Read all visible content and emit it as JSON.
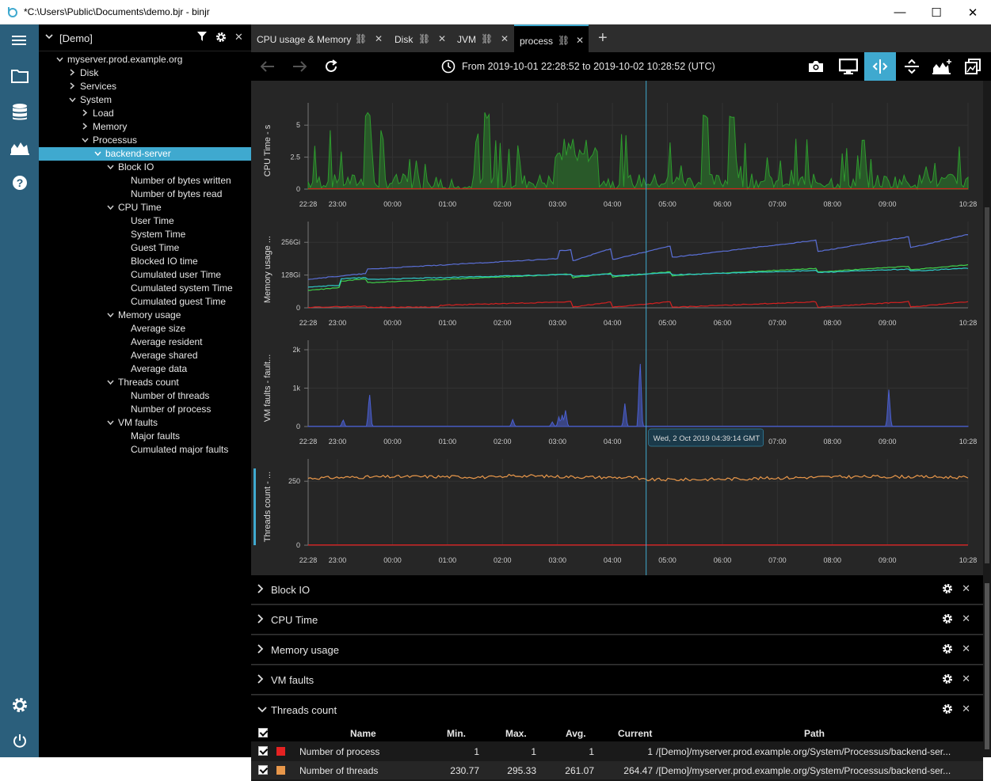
{
  "window": {
    "title": "*C:\\Users\\Public\\Documents\\demo.bjr - binjr",
    "minimize": "—",
    "maximize": "☐",
    "close": "✕"
  },
  "tree": {
    "root_label": "[Demo]",
    "nodes": [
      {
        "label": "myserver.prod.example.org",
        "depth": 0,
        "chev": "v"
      },
      {
        "label": "Disk",
        "depth": 1,
        "chev": ">"
      },
      {
        "label": "Services",
        "depth": 1,
        "chev": ">"
      },
      {
        "label": "System",
        "depth": 1,
        "chev": "v"
      },
      {
        "label": "Load",
        "depth": 2,
        "chev": ">"
      },
      {
        "label": "Memory",
        "depth": 2,
        "chev": ">"
      },
      {
        "label": "Processus",
        "depth": 2,
        "chev": "v"
      },
      {
        "label": "backend-server",
        "depth": 3,
        "chev": "v",
        "selected": true
      },
      {
        "label": "Block IO",
        "depth": 4,
        "chev": "v"
      },
      {
        "label": "Number of bytes written",
        "depth": 5,
        "chev": ""
      },
      {
        "label": "Number of bytes read",
        "depth": 5,
        "chev": ""
      },
      {
        "label": "CPU Time",
        "depth": 4,
        "chev": "v"
      },
      {
        "label": "User Time",
        "depth": 5,
        "chev": ""
      },
      {
        "label": "System Time",
        "depth": 5,
        "chev": ""
      },
      {
        "label": "Guest Time",
        "depth": 5,
        "chev": ""
      },
      {
        "label": "Blocked IO time",
        "depth": 5,
        "chev": ""
      },
      {
        "label": "Cumulated user Time",
        "depth": 5,
        "chev": ""
      },
      {
        "label": "Cumulated system Time",
        "depth": 5,
        "chev": ""
      },
      {
        "label": "Cumulated guest Time",
        "depth": 5,
        "chev": ""
      },
      {
        "label": "Memory usage",
        "depth": 4,
        "chev": "v"
      },
      {
        "label": "Average size",
        "depth": 5,
        "chev": ""
      },
      {
        "label": "Average resident",
        "depth": 5,
        "chev": ""
      },
      {
        "label": "Average shared",
        "depth": 5,
        "chev": ""
      },
      {
        "label": "Average data",
        "depth": 5,
        "chev": ""
      },
      {
        "label": "Threads count",
        "depth": 4,
        "chev": "v"
      },
      {
        "label": "Number of threads",
        "depth": 5,
        "chev": ""
      },
      {
        "label": "Number of process",
        "depth": 5,
        "chev": ""
      },
      {
        "label": "VM faults",
        "depth": 4,
        "chev": "v"
      },
      {
        "label": "Major faults",
        "depth": 5,
        "chev": ""
      },
      {
        "label": "Cumulated major faults",
        "depth": 5,
        "chev": ""
      }
    ]
  },
  "tabs": [
    {
      "label": "CPU usage & Memory"
    },
    {
      "label": "Disk"
    },
    {
      "label": "JVM"
    },
    {
      "label": "process",
      "active": true
    }
  ],
  "toolbar": {
    "time_range": "From 2019-10-01 22:28:52 to 2019-10-02 10:28:52 (UTC)"
  },
  "colors": {
    "accent": "#3fa9cf",
    "cpu_green": "#2e9a2e",
    "mem_blue": "#5a6fd6",
    "mem_green": "#3fd14a",
    "mem_cyan": "#2ec9c9",
    "red": "#d42020",
    "vm_blue": "#4a5fd0",
    "threads_orange": "#e8974a"
  },
  "chart_data": [
    {
      "type": "area",
      "ylabel": "CPU Time - s",
      "ylim": [
        0,
        6
      ],
      "yticks": [
        "0",
        "2.5",
        "5"
      ],
      "xticks": [
        "22:28",
        "23:00",
        "00:00",
        "01:00",
        "02:00",
        "03:00",
        "04:00",
        "05:00",
        "06:00",
        "07:00",
        "08:00",
        "09:00",
        "10:28"
      ],
      "series": [
        {
          "values_hint": "spiky green area 0–6 s, mostly 0–3 s"
        },
        {
          "values_hint": "flat red near 0"
        }
      ]
    },
    {
      "type": "line",
      "ylabel": "Memory usage ...",
      "ylim": [
        0,
        300
      ],
      "yticks": [
        "0",
        "128Gi",
        "256Gi"
      ],
      "xticks": [
        "22:28",
        "23:00",
        "00:00",
        "01:00",
        "02:00",
        "03:00",
        "04:00",
        "05:00",
        "06:00",
        "07:00",
        "08:00",
        "09:00",
        "10:28"
      ],
      "series": [
        {
          "values_hint": "blue ~110 rising to ~270 Gi with sawtooth drops"
        },
        {
          "values_hint": "green ~70 to ~160 Gi"
        },
        {
          "values_hint": "cyan ~80 to ~140 Gi"
        },
        {
          "values_hint": "red near 0 with small sawtooth to ~20 Gi"
        }
      ]
    },
    {
      "type": "area",
      "ylabel": "VM faults - fault...",
      "ylim": [
        0,
        2000
      ],
      "yticks": [
        "0",
        "1k",
        "2k"
      ],
      "xticks": [
        "22:28",
        "23:00",
        "00:00",
        "01:00",
        "02:00",
        "03:00",
        "04:00",
        "05:00",
        "06:00",
        "07:00",
        "08:00",
        "09:00",
        "10:28"
      ],
      "series": [
        {
          "values_hint": "near 0 with spikes ~900 at 23:30, ~250 at 02:45, ~1800 at 04:30, ~950 at 08:50"
        }
      ]
    },
    {
      "type": "line",
      "ylabel": "Threads count - ...",
      "ylim": [
        0,
        300
      ],
      "yticks": [
        "0",
        "250"
      ],
      "xticks": [
        "22:28",
        "23:00",
        "00:00",
        "01:00",
        "02:00",
        "03:00",
        "04:00",
        "05:00",
        "06:00",
        "07:00",
        "08:00",
        "09:00",
        "10:28"
      ],
      "series": [
        {
          "values_hint": "orange noisy ~255–285"
        },
        {
          "values_hint": "red flat at 1"
        }
      ]
    }
  ],
  "crosshair_tooltip": "Wed, 2 Oct 2019 04:39:14 GMT",
  "accordion": [
    {
      "label": "Block IO",
      "expanded": false
    },
    {
      "label": "CPU Time",
      "expanded": false
    },
    {
      "label": "Memory usage",
      "expanded": false
    },
    {
      "label": "VM faults",
      "expanded": false
    },
    {
      "label": "Threads count",
      "expanded": true
    }
  ],
  "threads_table": {
    "headers": [
      "Name",
      "Min.",
      "Max.",
      "Avg.",
      "Current",
      "Path"
    ],
    "rows": [
      {
        "color": "#e52222",
        "name": "Number of process",
        "min": "1",
        "max": "1",
        "avg": "1",
        "current": "1",
        "path": "/[Demo]/myserver.prod.example.org/System/Processus/backend-ser..."
      },
      {
        "color": "#e8974a",
        "name": "Number of threads",
        "min": "230.77",
        "max": "295.33",
        "avg": "261.07",
        "current": "264.47",
        "path": "/[Demo]/myserver.prod.example.org/System/Processus/backend-ser..."
      }
    ]
  }
}
